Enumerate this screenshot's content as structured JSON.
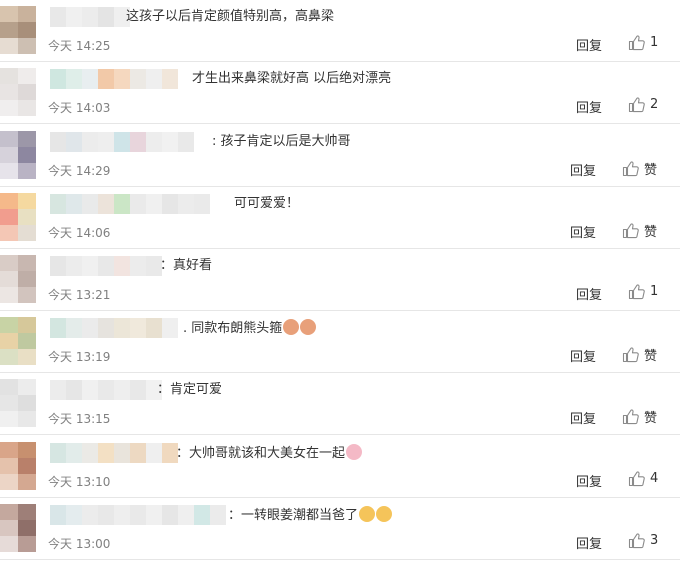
{
  "comments": [
    {
      "text": "这孩子以后肯定颜值特别高，高鼻梁",
      "time": "今天 14:25",
      "reply": "回复",
      "likes": "1",
      "name_colors": [
        "#e8e8e8",
        "#f0f0f0",
        "#ececec",
        "#e4e4e4",
        "#efefef"
      ],
      "avatar_colors": [
        "#d8c4ae",
        "#c9b29c",
        "#b6a08b",
        "#a88f7a",
        "#e6dcd2",
        "#cdbfb2"
      ]
    },
    {
      "text": "才生出来鼻梁就好高 以后绝对漂亮",
      "time": "今天 14:03",
      "reply": "回复",
      "likes": "2",
      "name_colors": [
        "#cfe7e0",
        "#dfeee9",
        "#e8eef0",
        "#f2c9a8",
        "#f5d8bf",
        "#ece9e4",
        "#efefef",
        "#f1e6da"
      ],
      "avatar_colors": [
        "#e5e2df",
        "#efeceb",
        "#e8e4e3",
        "#ded9d8",
        "#f0eeee",
        "#e9e6e5"
      ]
    },
    {
      "text": ": 孩子肯定以后是大帅哥",
      "time": "今天 14:29",
      "reply": "回复",
      "likes": "赞",
      "name_colors": [
        "#e6e6e6",
        "#e0e6ea",
        "#ececec",
        "#eeeeee",
        "#cfe4e8",
        "#e8d5dc",
        "#ededed",
        "#f1f1f1",
        "#e9e9e9"
      ],
      "avatar_colors": [
        "#c4c0cc",
        "#9c97a8",
        "#d6d2db",
        "#8d87a0",
        "#e6e3ea",
        "#b9b3c4"
      ]
    },
    {
      "text": "可可爱爱！",
      "time": "今天 14:06",
      "reply": "回复",
      "likes": "赞",
      "name_colors": [
        "#d7e6e0",
        "#dfe8ea",
        "#e9eaea",
        "#ece3da",
        "#cbe6c6",
        "#eaeaea",
        "#f0f0f0",
        "#e6e6e6",
        "#ececec",
        "#eaeaea"
      ],
      "avatar_colors": [
        "#f5b98a",
        "#f5d9a0",
        "#f19d8e",
        "#e8e0c2",
        "#f4c7b5",
        "#e4ddd3"
      ]
    },
    {
      "text": "：真好看",
      "time": "今天 13:21",
      "reply": "回复",
      "likes": "1",
      "name_colors": [
        "#e6e6e6",
        "#ececec",
        "#f0f0f0",
        "#e8e8e8",
        "#f2e4e0",
        "#ececec",
        "#e9e9e9"
      ],
      "avatar_colors": [
        "#d9ccc6",
        "#c8b7b0",
        "#e4dcd8",
        "#bfaea7",
        "#ece6e3",
        "#d2c4be"
      ]
    },
    {
      "text": ". 同款布朗熊头箍",
      "time": "今天 13:19",
      "reply": "回复",
      "likes": "赞",
      "name_colors": [
        "#d3e6e0",
        "#e4ecea",
        "#ebebeb",
        "#e6e3de",
        "#ece6d8",
        "#f0e9dc",
        "#e8e0d0",
        "#efefef"
      ],
      "avatar_colors": [
        "#c8d3a5",
        "#d6c89a",
        "#e8d2a6",
        "#bfc9a0",
        "#dbe0c4",
        "#e9dfc5"
      ]
    },
    {
      "text": "：肯定可爱",
      "time": "今天 13:15",
      "reply": "回复",
      "likes": "赞",
      "name_colors": [
        "#ececec",
        "#e6e6e6",
        "#f0f0f0",
        "#e9e9e9",
        "#eeeeee",
        "#e8e8e8",
        "#f1f1f1"
      ],
      "avatar_colors": [
        "#e2e2e2",
        "#ececec",
        "#e6e6e6",
        "#dedede",
        "#f0f0f0",
        "#e8e8e8"
      ]
    },
    {
      "text": "：大帅哥就该和大美女在一起",
      "time": "今天 13:10",
      "reply": "回复",
      "likes": "4",
      "name_colors": [
        "#d6e6e2",
        "#e2ecea",
        "#ebeae6",
        "#f3e0c4",
        "#e9e4dc",
        "#edd9c2",
        "#efefef",
        "#f0d9bf"
      ],
      "avatar_colors": [
        "#d9a589",
        "#c7906f",
        "#e5c2ac",
        "#b9806a",
        "#ecd5c6",
        "#d4a891"
      ]
    },
    {
      "text": "：一转眼姜潮都当爸了",
      "time": "今天 13:00",
      "reply": "回复",
      "likes": "3",
      "name_colors": [
        "#d9e6e8",
        "#e4ecee",
        "#ececec",
        "#e8e8e8",
        "#eeeeee",
        "#e9e9e9",
        "#f0f0f0",
        "#e6e6e6",
        "#efefef",
        "#d2e8e6",
        "#ebebeb"
      ],
      "avatar_colors": [
        "#c4a89e",
        "#9e7f78",
        "#d8c6c0",
        "#8f6f69",
        "#e6dbd8",
        "#b89c95"
      ]
    }
  ]
}
